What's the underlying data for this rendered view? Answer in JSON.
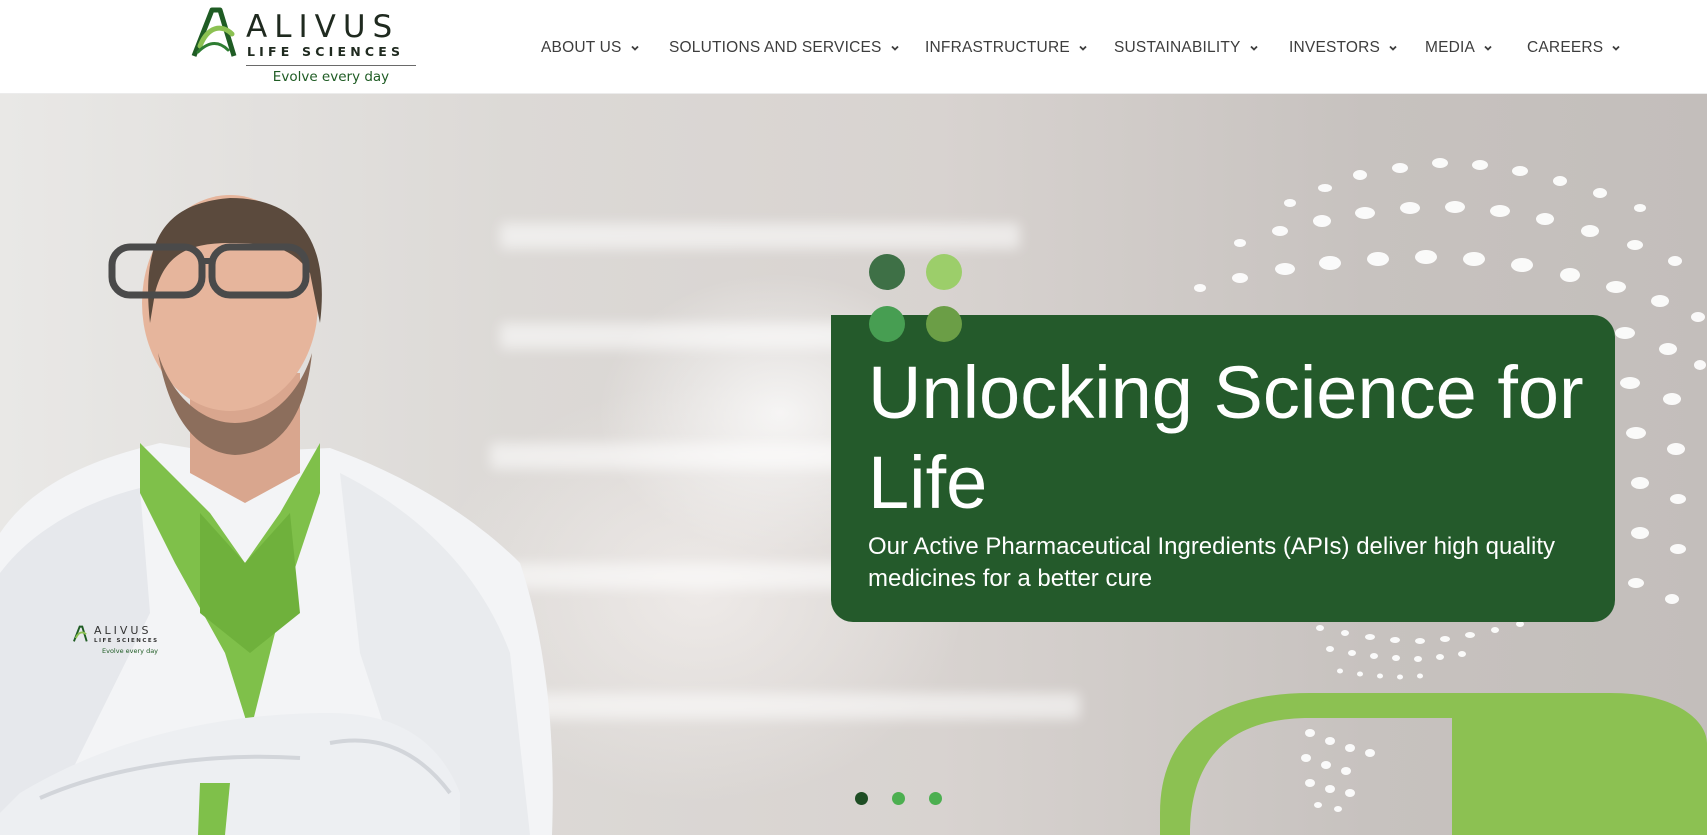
{
  "brand": {
    "name": "ALIVUS",
    "subname": "LIFE SCIENCES",
    "tagline": "Evolve every day"
  },
  "nav": {
    "items": [
      {
        "label": "ABOUT US"
      },
      {
        "label": "SOLUTIONS AND SERVICES"
      },
      {
        "label": "INFRASTRUCTURE"
      },
      {
        "label": "SUSTAINABILITY"
      },
      {
        "label": "INVESTORS"
      },
      {
        "label": "MEDIA"
      },
      {
        "label": "CAREERS"
      }
    ],
    "chevron_icon": "chevron-down-icon"
  },
  "hero": {
    "headline": "Unlocking Science for Life",
    "subtext": "Our Active Pharmaceutical Ingredients (APIs) deliver high quality medicines for a better cure",
    "coat_logo": {
      "name": "ALIVUS",
      "subname": "LIFE SCIENCES",
      "tagline": "Evolve every day"
    },
    "slider": {
      "total_slides": 3,
      "active_slide": 1
    }
  },
  "colors": {
    "brand_dark_green": "#245a2b",
    "brand_light_green": "#8cc152",
    "nav_text": "#3d3d3d",
    "pager_active": "#1e4d24",
    "pager_inactive": "#4caf50"
  }
}
